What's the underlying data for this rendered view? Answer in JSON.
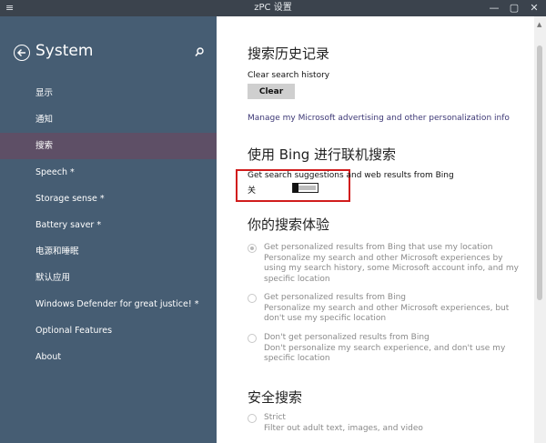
{
  "window": {
    "title": "zPC 设置",
    "controls": {
      "minimize": "—",
      "maximize": "▢",
      "close": "✕"
    }
  },
  "sidebar": {
    "title": "System",
    "items": [
      {
        "label": "显示",
        "selected": false
      },
      {
        "label": "通知",
        "selected": false
      },
      {
        "label": "搜索",
        "selected": true
      },
      {
        "label": "Speech *",
        "selected": false
      },
      {
        "label": "Storage sense *",
        "selected": false
      },
      {
        "label": "Battery saver *",
        "selected": false
      },
      {
        "label": "电源和睡眠",
        "selected": false
      },
      {
        "label": "默认应用",
        "selected": false
      },
      {
        "label": "Windows Defender for great justice! *",
        "selected": false
      },
      {
        "label": "Optional Features",
        "selected": false
      },
      {
        "label": "About",
        "selected": false
      }
    ]
  },
  "content": {
    "history": {
      "heading": "搜索历史记录",
      "clear_label": "Clear search history",
      "clear_button": "Clear",
      "manage_link": "Manage my Microsoft advertising and other personalization info"
    },
    "bing": {
      "heading": "使用 Bing 进行联机搜索",
      "suggestions_label": "Get search suggestions and web results from Bing",
      "toggle_state": "关",
      "toggle_on": false
    },
    "experience": {
      "heading": "你的搜索体验",
      "options": [
        {
          "title": "Get personalized results from Bing that use my location",
          "desc": "Personalize my search and other Microsoft experiences by using my search history, some Microsoft account info, and my specific location",
          "checked": true
        },
        {
          "title": "Get personalized results from Bing",
          "desc": "Personalize my search and other Microsoft experiences, but don't use my specific location",
          "checked": false
        },
        {
          "title": "Don't get personalized results from Bing",
          "desc": "Don't personalize my search experience, and don't use my specific location",
          "checked": false
        }
      ]
    },
    "safe": {
      "heading": "安全搜索",
      "options": [
        {
          "title": "Strict",
          "desc": "Filter out adult text, images, and video",
          "checked": false
        }
      ]
    }
  },
  "colors": {
    "sidebar_bg": "#465d73",
    "selected_bg": "#5e4f66",
    "link": "#3c3775",
    "highlight": "#d11c1c"
  }
}
